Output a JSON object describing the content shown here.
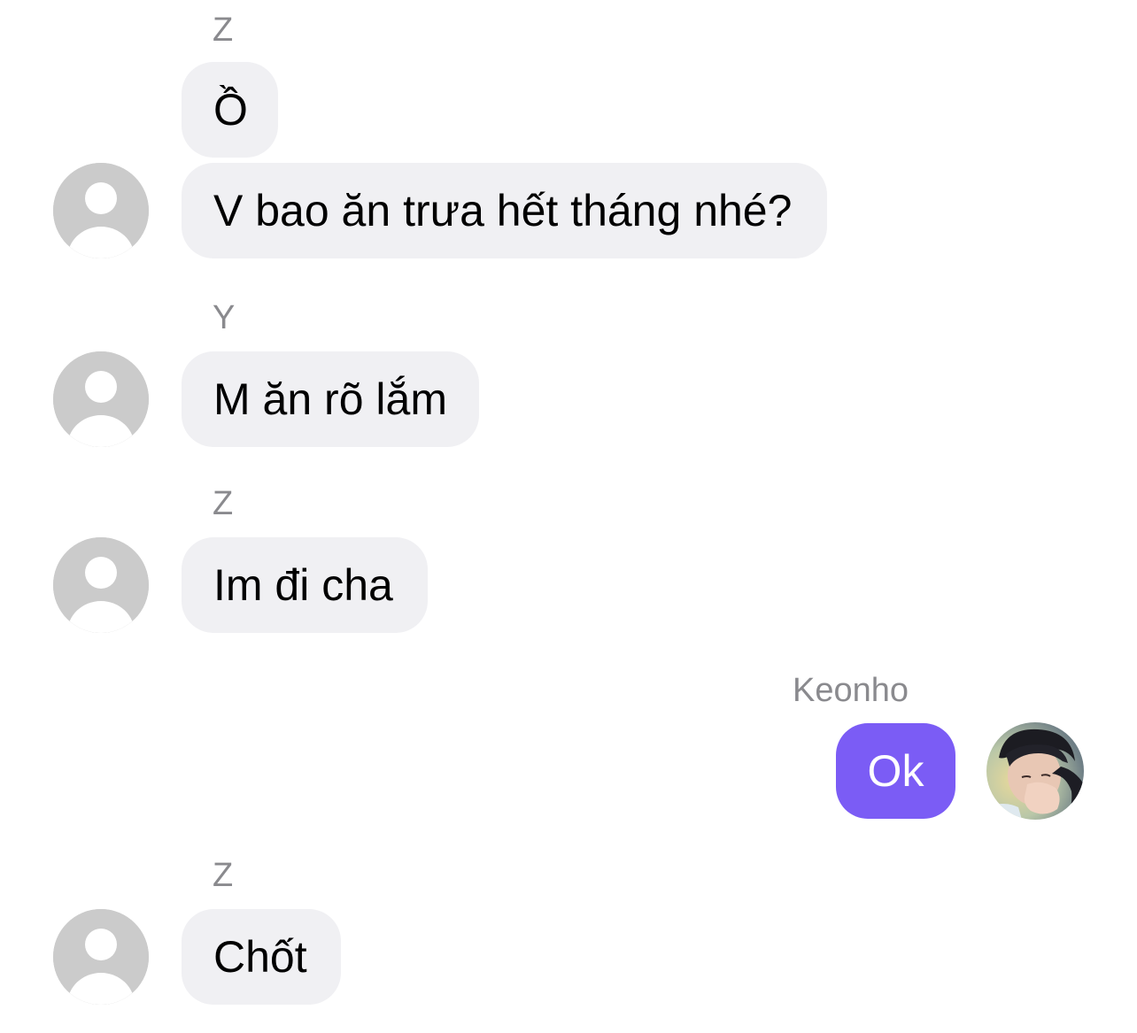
{
  "messages": [
    {
      "sender": "Z",
      "text": "Ồ"
    },
    {
      "text": "V bao ăn trưa hết tháng nhé?"
    },
    {
      "sender": "Y",
      "text": "M ăn rõ lắm"
    },
    {
      "sender": "Z",
      "text": "Im đi cha"
    },
    {
      "sender": "Keonho",
      "text": "Ok"
    },
    {
      "sender": "Z",
      "text": "Chốt"
    }
  ],
  "colors": {
    "incoming_bubble": "#f0f0f3",
    "outgoing_bubble": "#7b5cf5",
    "sender_name": "#8a8a8e",
    "avatar_placeholder": "#cbcbcb"
  },
  "icons": {
    "incoming_avatar": "default-user-avatar-icon",
    "outgoing_avatar": "user-photo-avatar"
  }
}
